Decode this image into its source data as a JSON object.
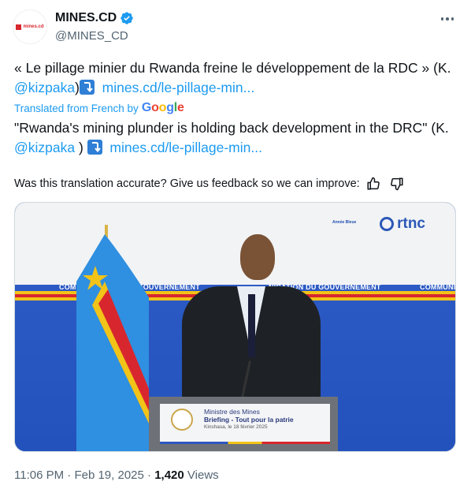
{
  "account": {
    "display_name": "MINES.CD",
    "handle": "@MINES_CD",
    "avatar_text": "mines.cd",
    "verified": true
  },
  "tweet": {
    "text_prefix": "« Le pillage minier du Rwanda freine le développement de la RDC » (K. ",
    "mention": "@kizpaka",
    "text_mid": ")",
    "link": "mines.cd/le-pillage-min..."
  },
  "translation": {
    "label": "Translated from French by",
    "google": [
      "G",
      "o",
      "o",
      "g",
      "l",
      "e"
    ],
    "text_prefix": "\"Rwanda's mining plunder is holding back development in the DRC\" (K. ",
    "mention": "@kizpaka",
    "text_mid": " )",
    "link": "mines.cd/le-pillage-min..."
  },
  "feedback": {
    "question": "Was this translation accurate? Give us feedback so we can improve:",
    "thumbs_up_icon": "thumbs-up-icon",
    "thumbs_down_icon": "thumbs-down-icon"
  },
  "media": {
    "banner_left": "COMMU",
    "banner_center_left": "N DU GOUVERNEMENT",
    "banner_center_right": "NICATION DU GOUVERNEMENT",
    "banner_right": "COMMUNI",
    "broadcaster": "rtnc",
    "small_logo": "Année Bleue",
    "podium_line1": "Ministre des Mines",
    "podium_line2": "Briefing - Tout pour la patrie",
    "podium_line3": "Kinshasa, le 18 février 2025"
  },
  "meta": {
    "time": "11:06 PM",
    "separator": " · ",
    "date": "Feb 19, 2025",
    "views_count": "1,420",
    "views_label": "Views"
  },
  "colors": {
    "link": "#1d9bf0",
    "text": "#0f1419",
    "secondary": "#536471",
    "verified": "#1d9bf0"
  }
}
